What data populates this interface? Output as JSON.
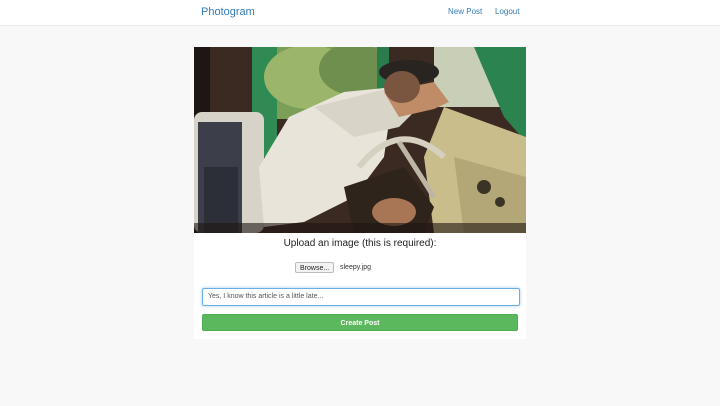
{
  "navbar": {
    "brand": "Photogram",
    "links": [
      {
        "label": "New Post"
      },
      {
        "label": "Logout"
      }
    ]
  },
  "form": {
    "upload_heading": "Upload an image (this is required):",
    "browse_label": "Browse...",
    "file_name": "sleepy.jpg",
    "caption_value": "Yes, I know this article is a little late...",
    "submit_label": "Create Post"
  },
  "colors": {
    "brand_link": "#337ab7",
    "submit_button": "#5cb85c",
    "input_focus_border": "#66afe9",
    "page_background": "#f8f8f8"
  }
}
